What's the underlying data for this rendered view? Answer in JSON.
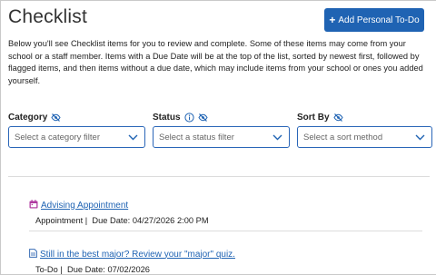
{
  "page": {
    "title": "Checklist",
    "add_button_label": "Add Personal To-Do",
    "intro": "Below you'll see Checklist items for you to review and complete. Some of these items may come from your school or a staff member. Items with a Due Date will be at the top of the list, sorted by newest first, followed by flagged items, and then items without a due date, which may include items from your school or ones you added yourself."
  },
  "filters": {
    "category": {
      "label": "Category",
      "placeholder": "Select a category filter"
    },
    "status": {
      "label": "Status",
      "placeholder": "Select a status filter"
    },
    "sort": {
      "label": "Sort By",
      "placeholder": "Select a sort method"
    }
  },
  "items": [
    {
      "title": "Advising Appointment",
      "type": "Appointment",
      "due_label": "Due Date:",
      "due": "04/27/2026 2:00 PM",
      "icon": "calendar-icon"
    },
    {
      "title": "Still in the best major? Review your \"major\" quiz.",
      "type": "To-Do",
      "due_label": "Due Date:",
      "due": "07/02/2026",
      "icon": "document-icon"
    }
  ],
  "colors": {
    "accent": "#1f63b3",
    "calendar_icon": "#b03aa0",
    "todo_icon": "#3b6fb6",
    "divider": "#dcdcdc"
  }
}
